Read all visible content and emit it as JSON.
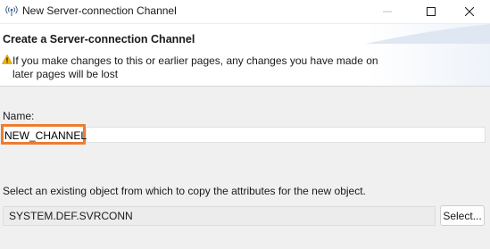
{
  "window": {
    "title": "New Server-connection Channel",
    "icon": "network-antenna-icon"
  },
  "controls": {
    "minimize_icon": "minimize-icon",
    "maximize_icon": "maximize-icon",
    "close_icon": "close-icon"
  },
  "header": {
    "title": "Create a Server-connection Channel",
    "warning_icon": "warning-icon",
    "warning_text": "If you make changes to this or earlier pages, any changes you have made on later pages will be lost"
  },
  "form": {
    "name_label": "Name:",
    "name_value": "NEW_CHANNEL",
    "copy_label": "Select an existing object from which to copy the attributes for the new object.",
    "copy_value": "SYSTEM.DEF.SVRCONN",
    "select_button": "Select..."
  },
  "colors": {
    "highlight": "#ed7d31",
    "warning": "#f0b400"
  }
}
